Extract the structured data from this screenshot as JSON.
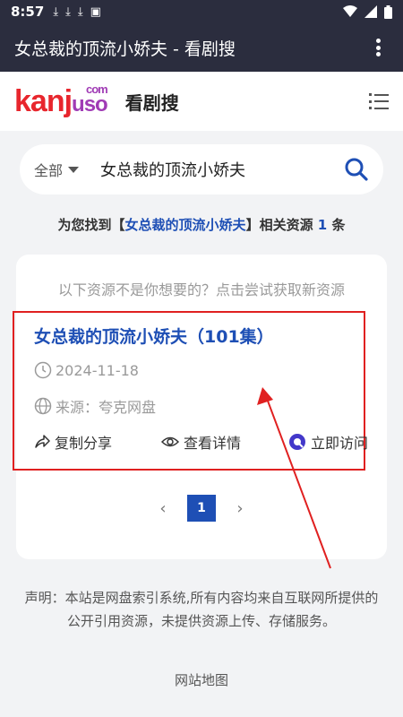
{
  "status_bar": {
    "time": "8:57"
  },
  "app_bar": {
    "title": "女总裁的顶流小娇夫 - 看剧搜"
  },
  "site_header": {
    "logo": {
      "part1": "kan",
      "part2": "j",
      "part3": "uso",
      "superscript": "com"
    },
    "site_name": "看剧搜"
  },
  "search": {
    "scope": "全部",
    "query": "女总裁的顶流小娇夫"
  },
  "result_count": {
    "prefix": "为您找到【",
    "keyword": "女总裁的顶流小娇夫",
    "middle": "】相关资源 ",
    "count": "1",
    "suffix": " 条"
  },
  "card": {
    "hint": "以下资源不是你想要的？点击尝试获取新资源",
    "item": {
      "title": "女总裁的顶流小娇夫（101集）",
      "date": "2024-11-18",
      "source": "来源：夸克网盘",
      "actions": {
        "share": "复制分享",
        "detail": "查看详情",
        "visit": "立即访问"
      }
    }
  },
  "pagination": {
    "current": "1"
  },
  "footer": {
    "disclaimer": "声明：本站是网盘索引系统,所有内容均来自互联网所提供的公开引用资源，未提供资源上传、存储服务。",
    "sitemap": "网站地图"
  },
  "colors": {
    "accent": "#1e4fb5",
    "annotation": "#e02020",
    "bar": "#2b2d3e"
  }
}
